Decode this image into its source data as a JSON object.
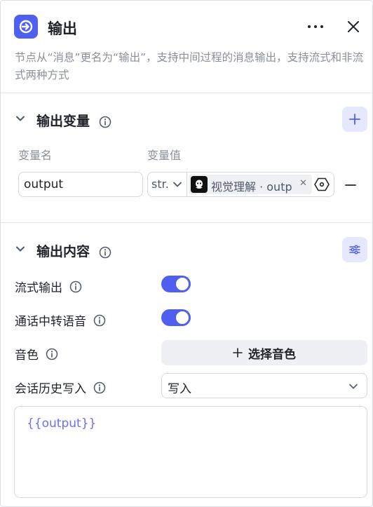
{
  "header": {
    "title": "输出",
    "description": "节点从“消息”更名为“输出”，支持中间过程的消息输出，支持流式和非流式两种方式"
  },
  "output_variables": {
    "title": "输出变量",
    "col_name": "变量名",
    "col_value": "变量值",
    "variable": {
      "name": "output",
      "type": "str.",
      "reference": "视觉理解 · output"
    }
  },
  "output_content": {
    "title": "输出内容",
    "streaming_label": "流式输出",
    "streaming_on": true,
    "tts_label": "通话中转语音",
    "tts_on": true,
    "voice_label": "音色",
    "voice_button": "选择音色",
    "history_label": "会话历史写入",
    "history_value": "写入",
    "template": "{{output}}"
  },
  "colors": {
    "accent": "#4f5ff0",
    "accent_soft": "#e6e8fd"
  }
}
